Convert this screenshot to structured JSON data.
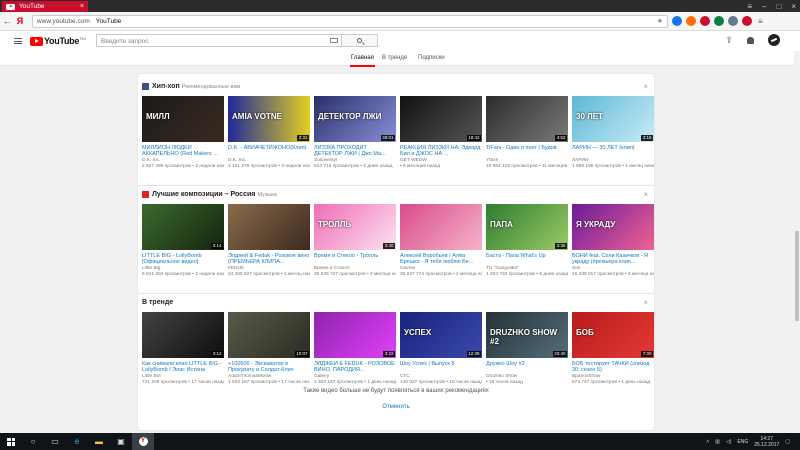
{
  "browser": {
    "tab_title": "YouTube",
    "url_host": "www.youtube.com",
    "url_title": "YouTube",
    "extension_colors": [
      "#1a73e8",
      "#ff6d00",
      "#c8102e",
      "#0b8043",
      "#607d8b",
      "#c8102e"
    ]
  },
  "masthead": {
    "logo_text": "YouTube",
    "region": "RU",
    "search_placeholder": "Введите запрос",
    "icons": [
      "upload-icon",
      "bell-icon",
      "avatar"
    ]
  },
  "nav": {
    "tabs": [
      {
        "label": "Главная",
        "active": true
      },
      {
        "label": "В тренде",
        "active": false
      },
      {
        "label": "Подписки",
        "active": false
      }
    ]
  },
  "shelves": [
    {
      "title": "Хип-хоп",
      "subtitle": "Рекомендованные вам",
      "icon_color": "#3d4f87",
      "videos": [
        {
          "title": "МИЛЛИОН ЛЮДЕЙ АККАПЕЛЬНО (Red Makers ...",
          "channel": "D.K. Inc.",
          "views": "2 607 496 просмотров",
          "age": "2 недели назад",
          "duration": "",
          "bg": "linear-gradient(135deg,#1b1b1b,#3a2a1f)",
          "overlay": "МИЛЛ"
        },
        {
          "title": "D.K. - АВИАЧЕТИЖОНО(Клип)",
          "channel": "D.K. Inc.",
          "views": "1 101 278 просмотров",
          "age": "3 недели назад",
          "duration": "2:31",
          "bg": "linear-gradient(90deg,#1f2a9a,#e3d021)",
          "overlay": "AMIA VOTNE"
        },
        {
          "title": "ЛИЗЗКА ПРОХОДИТ ДЕТЕКТОР ЛЖИ | Джо Ма...",
          "channel": "Solovievtyl",
          "views": "524 715 просмотров",
          "age": "6 дней назад",
          "duration": "39:01",
          "bg": "linear-gradient(135deg,#2a2f6b,#8a8fd6)",
          "overlay": "ДЕТЕКТОР ЛЖИ"
        },
        {
          "title": "РЕАКЦИЯ ЛИЗЗКИ НА: Эдвард Бил и ДЖОС НА ...",
          "channel": "GET WEDW",
          "views": "",
          "age": "6 месяцев назад",
          "duration": "18:42",
          "bg": "linear-gradient(135deg,#111,#555)",
          "overlay": ""
        },
        {
          "title": "TiFani - Один я поет | Будов",
          "channel": "Yfaxri",
          "views": "19 964 108 просмотров",
          "age": "11 месяцев назад",
          "duration": "4:52",
          "bg": "linear-gradient(135deg,#2c2c2c,#7a7a7a)",
          "overlay": ""
        },
        {
          "title": "ЛАРИН — 30 ЛЕТ (клип)",
          "channel": "ЛАРИН",
          "views": "1 888 196 просмотров",
          "age": "1 месяц назад",
          "duration": "3:16",
          "bg": "linear-gradient(135deg,#5bb7d6,#c9ecf5)",
          "overlay": "30 ЛЕТ"
        }
      ]
    },
    {
      "title": "Лучшие композиции – Россия",
      "subtitle": "Музыка",
      "icon_color": "#e62117",
      "videos": [
        {
          "title": "LITTLE BIG - LollyBomb [Официальное видео]",
          "channel": "Little Big",
          "views": "6 841 304 просмотров",
          "age": "2 недели назад",
          "duration": "3:14",
          "bg": "linear-gradient(135deg,#3b6b2c,#14240f)",
          "overlay": ""
        },
        {
          "title": "Элджей & Feduk - Розовое вино (ПРЕМЬЕРА КЛИПА...",
          "channel": "FEDUK",
          "views": "24 465 627 просмотров",
          "age": "1 месяц назад",
          "duration": "",
          "bg": "linear-gradient(135deg,#8a6a4a,#3c2b1f)",
          "overlay": ""
        },
        {
          "title": "Время и Стекло - Тролль",
          "channel": "Время и Стекло",
          "views": "36 929 727 просмотров",
          "age": "2 месяца назад",
          "duration": "3:40",
          "bg": "linear-gradient(135deg,#f06db7,#fbe3f1)",
          "overlay": "ТРОЛЛЬ"
        },
        {
          "title": "Алексей Воробьев / Алёа Брешко - Я тебя люблю Бе...",
          "channel": "Gavrilo",
          "views": "26 037 774 просмотров",
          "age": "2 месяца назад",
          "duration": "",
          "bg": "linear-gradient(135deg,#d84b8a,#f7b3c9)",
          "overlay": ""
        },
        {
          "title": "Баста - Папа What's Up",
          "channel": "TU \"Gazgolder\"",
          "views": "1 604 733 просмотров",
          "age": "5 дней назад",
          "duration": "3:35",
          "bg": "linear-gradient(135deg,#2e7d32,#9ccc65)",
          "overlay": "ПАПА"
        },
        {
          "title": "ВОНИ feat. Соли Казачков - Я украду (премьера клип...",
          "channel": "Soli",
          "views": "16 338 017 просмотров",
          "age": "2 месяца назад",
          "duration": "",
          "bg": "linear-gradient(135deg,#6a1b9a,#f06292)",
          "overlay": "Я УКРАДУ"
        }
      ]
    },
    {
      "title": "В тренде",
      "subtitle": "",
      "icon_color": "",
      "videos": [
        {
          "title": "Как снимали клип LITTLE BIG - LollyBomb / Элас Истина",
          "channel": "Little Bot",
          "views": "721 209 просмотров",
          "age": "17 часов назад",
          "duration": "3:12",
          "bg": "linear-gradient(135deg,#444,#0d0d0d)",
          "overlay": ""
        },
        {
          "title": "+100500 - Экскаватор в Прокурату и Солдат-Клич",
          "channel": "AdamThomasMoran",
          "views": "1 533 167 просмотров",
          "age": "17 часов назад",
          "duration": "10:07",
          "bg": "linear-gradient(135deg,#5a5a4a,#2b2b22)",
          "overlay": ""
        },
        {
          "title": "ЭЛДЖЕЙ & FEDUK - РОЗОВОЕ ВИНО. ПАРОДИЯ...",
          "channel": "Gallery",
          "views": "1 303 197 просмотров",
          "age": "1 день назад",
          "duration": "3:22",
          "bg": "linear-gradient(135deg,#8e24aa,#e040fb)",
          "overlay": ""
        },
        {
          "title": "Шоу Успех | Выпуск 8",
          "channel": "СТС",
          "views": "140 027 просмотров",
          "age": "15 часов назад",
          "duration": "12:39",
          "bg": "linear-gradient(135deg,#1a237e,#3949ab)",
          "overlay": "УСПЕХ"
        },
        {
          "title": "Дружко Шоу #2",
          "channel": "Druzhko Show",
          "views": "",
          "age": "16 часов назад",
          "duration": "33:40",
          "bg": "linear-gradient(135deg,#263238,#546e7a)",
          "overlay": "DRUZHKO SHOW #2"
        },
        {
          "title": "БОБ тестирует ТАЧКИ (эпизод 30, сезон 5)",
          "channel": "BpanovShow",
          "views": "574 747 просмотров",
          "age": "1 день назад",
          "duration": "7:00",
          "bg": "linear-gradient(135deg,#b71c1c,#e53935)",
          "overlay": "БОБ"
        }
      ]
    }
  ],
  "footer": {
    "note": "Такие видео больше не будут появляться в ваших рекомендациях",
    "cancel": "Отменить"
  },
  "taskbar": {
    "lang": "ENG",
    "time": "14:27",
    "date": "25.12.2017"
  }
}
